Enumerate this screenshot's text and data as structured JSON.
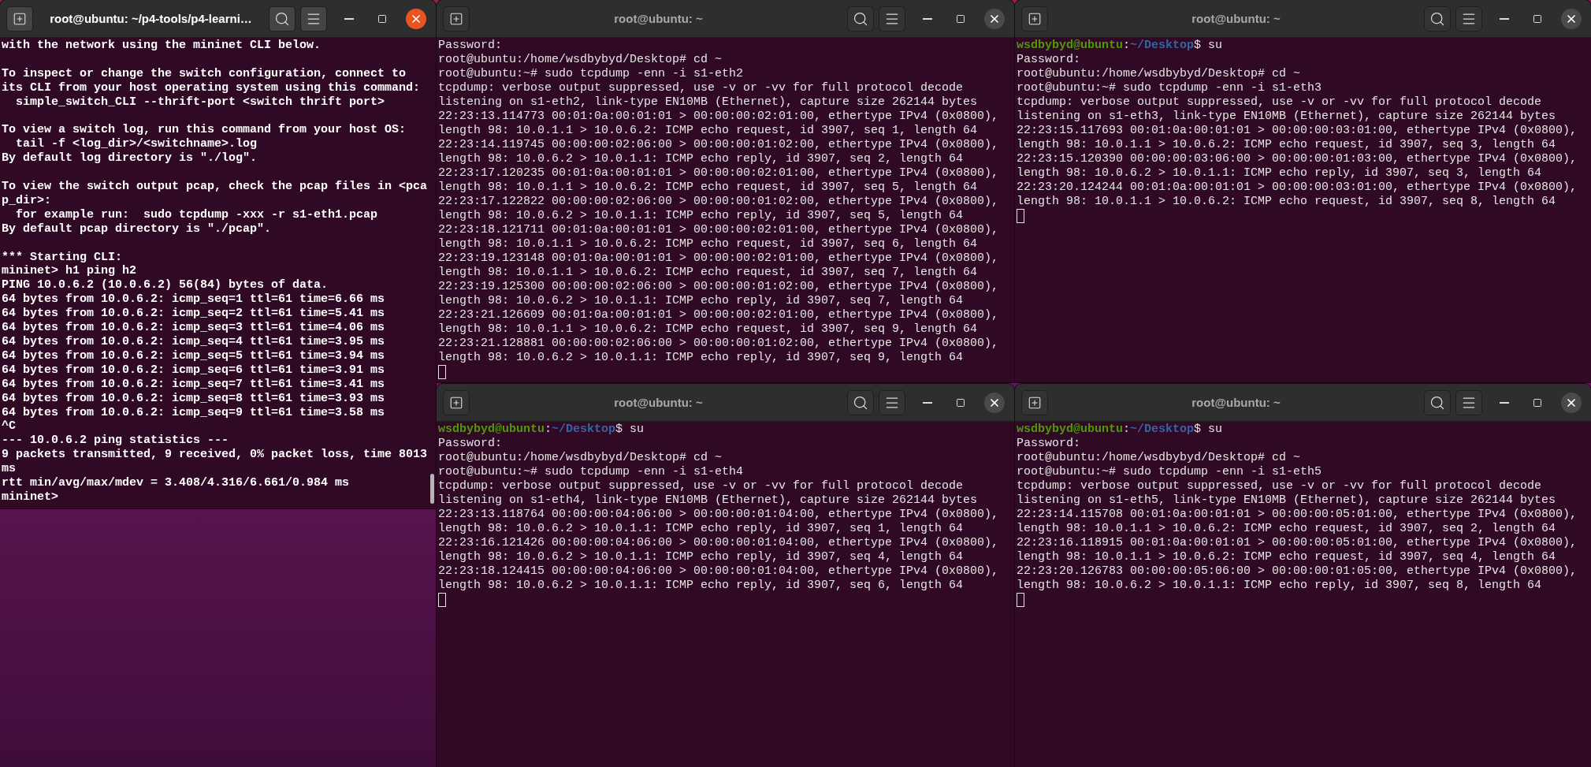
{
  "windows": [
    {
      "title": "root@ubuntu: ~/p4-tools/p4-learni…",
      "active": true,
      "cursor": false,
      "lines": [
        {
          "kind": "text",
          "text": "with the network using the mininet CLI below."
        },
        {
          "kind": "blank"
        },
        {
          "kind": "text",
          "text": "To inspect or change the switch configuration, connect to"
        },
        {
          "kind": "text",
          "text": "its CLI from your host operating system using this command:"
        },
        {
          "kind": "text",
          "text": "  simple_switch_CLI --thrift-port <switch thrift port>"
        },
        {
          "kind": "blank"
        },
        {
          "kind": "text",
          "text": "To view a switch log, run this command from your host OS:"
        },
        {
          "kind": "text",
          "text": "  tail -f <log_dir>/<switchname>.log"
        },
        {
          "kind": "text",
          "text": "By default log directory is \"./log\"."
        },
        {
          "kind": "blank"
        },
        {
          "kind": "text",
          "text": "To view the switch output pcap, check the pcap files in <pca"
        },
        {
          "kind": "text",
          "text": "p_dir>:"
        },
        {
          "kind": "text",
          "text": "  for example run:  sudo tcpdump -xxx -r s1-eth1.pcap"
        },
        {
          "kind": "text",
          "text": "By default pcap directory is \"./pcap\"."
        },
        {
          "kind": "blank"
        },
        {
          "kind": "text",
          "text": "*** Starting CLI:"
        },
        {
          "kind": "text",
          "text": "mininet> h1 ping h2"
        },
        {
          "kind": "text",
          "text": "PING 10.0.6.2 (10.0.6.2) 56(84) bytes of data."
        },
        {
          "kind": "text",
          "text": "64 bytes from 10.0.6.2: icmp_seq=1 ttl=61 time=6.66 ms"
        },
        {
          "kind": "text",
          "text": "64 bytes from 10.0.6.2: icmp_seq=2 ttl=61 time=5.41 ms"
        },
        {
          "kind": "text",
          "text": "64 bytes from 10.0.6.2: icmp_seq=3 ttl=61 time=4.06 ms"
        },
        {
          "kind": "text",
          "text": "64 bytes from 10.0.6.2: icmp_seq=4 ttl=61 time=3.95 ms"
        },
        {
          "kind": "text",
          "text": "64 bytes from 10.0.6.2: icmp_seq=5 ttl=61 time=3.94 ms"
        },
        {
          "kind": "text",
          "text": "64 bytes from 10.0.6.2: icmp_seq=6 ttl=61 time=3.91 ms"
        },
        {
          "kind": "text",
          "text": "64 bytes from 10.0.6.2: icmp_seq=7 ttl=61 time=3.41 ms"
        },
        {
          "kind": "text",
          "text": "64 bytes from 10.0.6.2: icmp_seq=8 ttl=61 time=3.93 ms"
        },
        {
          "kind": "text",
          "text": "64 bytes from 10.0.6.2: icmp_seq=9 ttl=61 time=3.58 ms"
        },
        {
          "kind": "text",
          "text": "^C"
        },
        {
          "kind": "text",
          "text": "--- 10.0.6.2 ping statistics ---"
        },
        {
          "kind": "text",
          "text": "9 packets transmitted, 9 received, 0% packet loss, time 8013"
        },
        {
          "kind": "text",
          "text": "ms"
        },
        {
          "kind": "text",
          "text": "rtt min/avg/max/mdev = 3.408/4.316/6.661/0.984 ms"
        },
        {
          "kind": "text",
          "text": "mininet>"
        }
      ]
    },
    {
      "title": "root@ubuntu: ~",
      "active": false,
      "cursor": true,
      "lines": [
        {
          "kind": "text",
          "text": "Password:"
        },
        {
          "kind": "text",
          "text": "root@ubuntu:/home/wsdbybyd/Desktop# cd ~"
        },
        {
          "kind": "text",
          "text": "root@ubuntu:~# sudo tcpdump -enn -i s1-eth2"
        },
        {
          "kind": "text",
          "text": "tcpdump: verbose output suppressed, use -v or -vv for full protocol decode"
        },
        {
          "kind": "text",
          "text": "listening on s1-eth2, link-type EN10MB (Ethernet), capture size 262144 bytes"
        },
        {
          "kind": "text",
          "text": "22:23:13.114773 00:01:0a:00:01:01 > 00:00:00:02:01:00, ethertype IPv4 (0x0800),"
        },
        {
          "kind": "text",
          "text": "length 98: 10.0.1.1 > 10.0.6.2: ICMP echo request, id 3907, seq 1, length 64"
        },
        {
          "kind": "text",
          "text": "22:23:14.119745 00:00:00:02:06:00 > 00:00:00:01:02:00, ethertype IPv4 (0x0800),"
        },
        {
          "kind": "text",
          "text": "length 98: 10.0.6.2 > 10.0.1.1: ICMP echo reply, id 3907, seq 2, length 64"
        },
        {
          "kind": "text",
          "text": "22:23:17.120235 00:01:0a:00:01:01 > 00:00:00:02:01:00, ethertype IPv4 (0x0800),"
        },
        {
          "kind": "text",
          "text": "length 98: 10.0.1.1 > 10.0.6.2: ICMP echo request, id 3907, seq 5, length 64"
        },
        {
          "kind": "text",
          "text": "22:23:17.122822 00:00:00:02:06:00 > 00:00:00:01:02:00, ethertype IPv4 (0x0800),"
        },
        {
          "kind": "text",
          "text": "length 98: 10.0.6.2 > 10.0.1.1: ICMP echo reply, id 3907, seq 5, length 64"
        },
        {
          "kind": "text",
          "text": "22:23:18.121711 00:01:0a:00:01:01 > 00:00:00:02:01:00, ethertype IPv4 (0x0800),"
        },
        {
          "kind": "text",
          "text": "length 98: 10.0.1.1 > 10.0.6.2: ICMP echo request, id 3907, seq 6, length 64"
        },
        {
          "kind": "text",
          "text": "22:23:19.123148 00:01:0a:00:01:01 > 00:00:00:02:01:00, ethertype IPv4 (0x0800),"
        },
        {
          "kind": "text",
          "text": "length 98: 10.0.1.1 > 10.0.6.2: ICMP echo request, id 3907, seq 7, length 64"
        },
        {
          "kind": "text",
          "text": "22:23:19.125300 00:00:00:02:06:00 > 00:00:00:01:02:00, ethertype IPv4 (0x0800),"
        },
        {
          "kind": "text",
          "text": "length 98: 10.0.6.2 > 10.0.1.1: ICMP echo reply, id 3907, seq 7, length 64"
        },
        {
          "kind": "text",
          "text": "22:23:21.126609 00:01:0a:00:01:01 > 00:00:00:02:01:00, ethertype IPv4 (0x0800),"
        },
        {
          "kind": "text",
          "text": "length 98: 10.0.1.1 > 10.0.6.2: ICMP echo request, id 3907, seq 9, length 64"
        },
        {
          "kind": "text",
          "text": "22:23:21.128881 00:00:00:02:06:00 > 00:00:00:01:02:00, ethertype IPv4 (0x0800),"
        },
        {
          "kind": "text",
          "text": "length 98: 10.0.6.2 > 10.0.1.1: ICMP echo reply, id 3907, seq 9, length 64"
        }
      ]
    },
    {
      "title": "root@ubuntu: ~",
      "active": false,
      "cursor": true,
      "lines": [
        {
          "kind": "prompt",
          "user": "wsdbybyd@ubuntu",
          "sep": ":",
          "path": "~/Desktop",
          "command": "$ su"
        },
        {
          "kind": "text",
          "text": "Password:"
        },
        {
          "kind": "text",
          "text": "root@ubuntu:/home/wsdbybyd/Desktop# cd ~"
        },
        {
          "kind": "text",
          "text": "root@ubuntu:~# sudo tcpdump -enn -i s1-eth3"
        },
        {
          "kind": "text",
          "text": "tcpdump: verbose output suppressed, use -v or -vv for full protocol decode"
        },
        {
          "kind": "text",
          "text": "listening on s1-eth3, link-type EN10MB (Ethernet), capture size 262144 bytes"
        },
        {
          "kind": "text",
          "text": "22:23:15.117693 00:01:0a:00:01:01 > 00:00:00:03:01:00, ethertype IPv4 (0x0800),"
        },
        {
          "kind": "text",
          "text": "length 98: 10.0.1.1 > 10.0.6.2: ICMP echo request, id 3907, seq 3, length 64"
        },
        {
          "kind": "text",
          "text": "22:23:15.120390 00:00:00:03:06:00 > 00:00:00:01:03:00, ethertype IPv4 (0x0800),"
        },
        {
          "kind": "text",
          "text": "length 98: 10.0.6.2 > 10.0.1.1: ICMP echo reply, id 3907, seq 3, length 64"
        },
        {
          "kind": "text",
          "text": "22:23:20.124244 00:01:0a:00:01:01 > 00:00:00:03:01:00, ethertype IPv4 (0x0800),"
        },
        {
          "kind": "text",
          "text": "length 98: 10.0.1.1 > 10.0.6.2: ICMP echo request, id 3907, seq 8, length 64"
        }
      ]
    },
    {
      "title": "root@ubuntu: ~",
      "active": false,
      "cursor": true,
      "lines": [
        {
          "kind": "prompt",
          "user": "wsdbybyd@ubuntu",
          "sep": ":",
          "path": "~/Desktop",
          "command": "$ su"
        },
        {
          "kind": "text",
          "text": "Password:"
        },
        {
          "kind": "text",
          "text": "root@ubuntu:/home/wsdbybyd/Desktop# cd ~"
        },
        {
          "kind": "text",
          "text": "root@ubuntu:~# sudo tcpdump -enn -i s1-eth4"
        },
        {
          "kind": "text",
          "text": "tcpdump: verbose output suppressed, use -v or -vv for full protocol decode"
        },
        {
          "kind": "text",
          "text": "listening on s1-eth4, link-type EN10MB (Ethernet), capture size 262144 bytes"
        },
        {
          "kind": "text",
          "text": "22:23:13.118764 00:00:00:04:06:00 > 00:00:00:01:04:00, ethertype IPv4 (0x0800),"
        },
        {
          "kind": "text",
          "text": "length 98: 10.0.6.2 > 10.0.1.1: ICMP echo reply, id 3907, seq 1, length 64"
        },
        {
          "kind": "text",
          "text": "22:23:16.121426 00:00:00:04:06:00 > 00:00:00:01:04:00, ethertype IPv4 (0x0800),"
        },
        {
          "kind": "text",
          "text": "length 98: 10.0.6.2 > 10.0.1.1: ICMP echo reply, id 3907, seq 4, length 64"
        },
        {
          "kind": "text",
          "text": "22:23:18.124415 00:00:00:04:06:00 > 00:00:00:01:04:00, ethertype IPv4 (0x0800),"
        },
        {
          "kind": "text",
          "text": "length 98: 10.0.6.2 > 10.0.1.1: ICMP echo reply, id 3907, seq 6, length 64"
        }
      ]
    },
    {
      "title": "root@ubuntu: ~",
      "active": false,
      "cursor": true,
      "lines": [
        {
          "kind": "prompt",
          "user": "wsdbybyd@ubuntu",
          "sep": ":",
          "path": "~/Desktop",
          "command": "$ su"
        },
        {
          "kind": "text",
          "text": "Password:"
        },
        {
          "kind": "text",
          "text": "root@ubuntu:/home/wsdbybyd/Desktop# cd ~"
        },
        {
          "kind": "text",
          "text": "root@ubuntu:~# sudo tcpdump -enn -i s1-eth5"
        },
        {
          "kind": "text",
          "text": "tcpdump: verbose output suppressed, use -v or -vv for full protocol decode"
        },
        {
          "kind": "text",
          "text": "listening on s1-eth5, link-type EN10MB (Ethernet), capture size 262144 bytes"
        },
        {
          "kind": "text",
          "text": "22:23:14.115708 00:01:0a:00:01:01 > 00:00:00:05:01:00, ethertype IPv4 (0x0800),"
        },
        {
          "kind": "text",
          "text": "length 98: 10.0.1.1 > 10.0.6.2: ICMP echo request, id 3907, seq 2, length 64"
        },
        {
          "kind": "text",
          "text": "22:23:16.118915 00:01:0a:00:01:01 > 00:00:00:05:01:00, ethertype IPv4 (0x0800),"
        },
        {
          "kind": "text",
          "text": "length 98: 10.0.1.1 > 10.0.6.2: ICMP echo request, id 3907, seq 4, length 64"
        },
        {
          "kind": "text",
          "text": "22:23:20.126783 00:00:00:05:06:00 > 00:00:00:01:05:00, ethertype IPv4 (0x0800),"
        },
        {
          "kind": "text",
          "text": "length 98: 10.0.6.2 > 10.0.1.1: ICMP echo reply, id 3907, seq 8, length 64"
        }
      ]
    }
  ]
}
